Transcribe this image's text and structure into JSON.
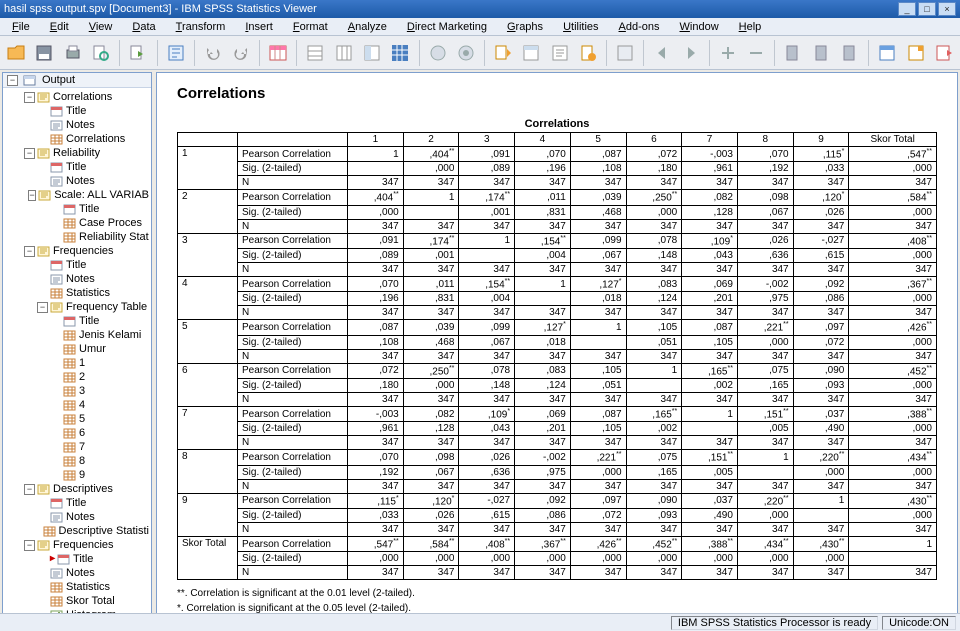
{
  "window": {
    "title": "hasil spss output.spv [Document3] - IBM SPSS Statistics Viewer",
    "min": "_",
    "max": "□",
    "close": "×"
  },
  "menu": [
    "File",
    "Edit",
    "View",
    "Data",
    "Transform",
    "Insert",
    "Format",
    "Analyze",
    "Direct Marketing",
    "Graphs",
    "Utilities",
    "Add-ons",
    "Window",
    "Help"
  ],
  "outline_root": "Output",
  "outline": [
    {
      "d": 1,
      "t": "-",
      "i": "log",
      "l": "Correlations"
    },
    {
      "d": 2,
      "t": " ",
      "i": "title",
      "l": "Title"
    },
    {
      "d": 2,
      "t": " ",
      "i": "notes",
      "l": "Notes"
    },
    {
      "d": 2,
      "t": " ",
      "i": "tbl",
      "l": "Correlations"
    },
    {
      "d": 1,
      "t": "-",
      "i": "log",
      "l": "Reliability"
    },
    {
      "d": 2,
      "t": " ",
      "i": "title",
      "l": "Title"
    },
    {
      "d": 2,
      "t": " ",
      "i": "notes",
      "l": "Notes"
    },
    {
      "d": 2,
      "t": "-",
      "i": "log",
      "l": "Scale: ALL VARIAB"
    },
    {
      "d": 3,
      "t": " ",
      "i": "title",
      "l": "Title"
    },
    {
      "d": 3,
      "t": " ",
      "i": "tbl",
      "l": "Case Proces"
    },
    {
      "d": 3,
      "t": " ",
      "i": "tbl",
      "l": "Reliability Stat"
    },
    {
      "d": 1,
      "t": "-",
      "i": "log",
      "l": "Frequencies"
    },
    {
      "d": 2,
      "t": " ",
      "i": "title",
      "l": "Title"
    },
    {
      "d": 2,
      "t": " ",
      "i": "notes",
      "l": "Notes"
    },
    {
      "d": 2,
      "t": " ",
      "i": "tbl",
      "l": "Statistics"
    },
    {
      "d": 2,
      "t": "-",
      "i": "log",
      "l": "Frequency Table"
    },
    {
      "d": 3,
      "t": " ",
      "i": "title",
      "l": "Title"
    },
    {
      "d": 3,
      "t": " ",
      "i": "tbl",
      "l": "Jenis Kelami"
    },
    {
      "d": 3,
      "t": " ",
      "i": "tbl",
      "l": "Umur"
    },
    {
      "d": 3,
      "t": " ",
      "i": "tbl",
      "l": "1"
    },
    {
      "d": 3,
      "t": " ",
      "i": "tbl",
      "l": "2"
    },
    {
      "d": 3,
      "t": " ",
      "i": "tbl",
      "l": "3"
    },
    {
      "d": 3,
      "t": " ",
      "i": "tbl",
      "l": "4"
    },
    {
      "d": 3,
      "t": " ",
      "i": "tbl",
      "l": "5"
    },
    {
      "d": 3,
      "t": " ",
      "i": "tbl",
      "l": "6"
    },
    {
      "d": 3,
      "t": " ",
      "i": "tbl",
      "l": "7"
    },
    {
      "d": 3,
      "t": " ",
      "i": "tbl",
      "l": "8"
    },
    {
      "d": 3,
      "t": " ",
      "i": "tbl",
      "l": "9"
    },
    {
      "d": 1,
      "t": "-",
      "i": "log",
      "l": "Descriptives"
    },
    {
      "d": 2,
      "t": " ",
      "i": "title",
      "l": "Title"
    },
    {
      "d": 2,
      "t": " ",
      "i": "notes",
      "l": "Notes"
    },
    {
      "d": 2,
      "t": " ",
      "i": "tbl",
      "l": "Descriptive Statisti"
    },
    {
      "d": 1,
      "t": "-",
      "i": "log",
      "l": "Frequencies"
    },
    {
      "d": 2,
      "t": " ",
      "i": "title",
      "l": "Title",
      "sel": true
    },
    {
      "d": 2,
      "t": " ",
      "i": "notes",
      "l": "Notes"
    },
    {
      "d": 2,
      "t": " ",
      "i": "tbl",
      "l": "Statistics"
    },
    {
      "d": 2,
      "t": " ",
      "i": "tbl",
      "l": "Skor Total"
    },
    {
      "d": 2,
      "t": " ",
      "i": "chart",
      "l": "Histogram"
    }
  ],
  "heading": "Correlations",
  "table_caption": "Correlations",
  "columns": [
    "1",
    "2",
    "3",
    "4",
    "5",
    "6",
    "7",
    "8",
    "9",
    "Skor Total"
  ],
  "rowlabels": [
    "Pearson Correlation",
    "Sig. (2-tailed)",
    "N"
  ],
  "groups": [
    "1",
    "2",
    "3",
    "4",
    "5",
    "6",
    "7",
    "8",
    "9",
    "Skor Total"
  ],
  "matrix": [
    {
      "pc": [
        "1",
        ",404<sup>**</sup>",
        ",091",
        ",070",
        ",087",
        ",072",
        "-,003",
        ",070",
        ",115<sup>*</sup>",
        ",547<sup>**</sup>"
      ],
      "sig": [
        "",
        ",000",
        ",089",
        ",196",
        ",108",
        ",180",
        ",961",
        ",192",
        ",033",
        ",000"
      ],
      "n": [
        "347",
        "347",
        "347",
        "347",
        "347",
        "347",
        "347",
        "347",
        "347",
        "347"
      ]
    },
    {
      "pc": [
        ",404<sup>**</sup>",
        "1",
        ",174<sup>**</sup>",
        ",011",
        ",039",
        ",250<sup>**</sup>",
        ",082",
        ",098",
        ",120<sup>*</sup>",
        ",584<sup>**</sup>"
      ],
      "sig": [
        ",000",
        "",
        ",001",
        ",831",
        ",468",
        ",000",
        ",128",
        ",067",
        ",026",
        ",000"
      ],
      "n": [
        "347",
        "347",
        "347",
        "347",
        "347",
        "347",
        "347",
        "347",
        "347",
        "347"
      ]
    },
    {
      "pc": [
        ",091",
        ",174<sup>**</sup>",
        "1",
        ",154<sup>**</sup>",
        ",099",
        ",078",
        ",109<sup>*</sup>",
        ",026",
        "-,027",
        ",408<sup>**</sup>"
      ],
      "sig": [
        ",089",
        ",001",
        "",
        ",004",
        ",067",
        ",148",
        ",043",
        ",636",
        ",615",
        ",000"
      ],
      "n": [
        "347",
        "347",
        "347",
        "347",
        "347",
        "347",
        "347",
        "347",
        "347",
        "347"
      ]
    },
    {
      "pc": [
        ",070",
        ",011",
        ",154<sup>**</sup>",
        "1",
        ",127<sup>*</sup>",
        ",083",
        ",069",
        "-,002",
        ",092",
        ",367<sup>**</sup>"
      ],
      "sig": [
        ",196",
        ",831",
        ",004",
        "",
        ",018",
        ",124",
        ",201",
        ",975",
        ",086",
        ",000"
      ],
      "n": [
        "347",
        "347",
        "347",
        "347",
        "347",
        "347",
        "347",
        "347",
        "347",
        "347"
      ]
    },
    {
      "pc": [
        ",087",
        ",039",
        ",099",
        ",127<sup>*</sup>",
        "1",
        ",105",
        ",087",
        ",221<sup>**</sup>",
        ",097",
        ",426<sup>**</sup>"
      ],
      "sig": [
        ",108",
        ",468",
        ",067",
        ",018",
        "",
        ",051",
        ",105",
        ",000",
        ",072",
        ",000"
      ],
      "n": [
        "347",
        "347",
        "347",
        "347",
        "347",
        "347",
        "347",
        "347",
        "347",
        "347"
      ]
    },
    {
      "pc": [
        ",072",
        ",250<sup>**</sup>",
        ",078",
        ",083",
        ",105",
        "1",
        ",165<sup>**</sup>",
        ",075",
        ",090",
        ",452<sup>**</sup>"
      ],
      "sig": [
        ",180",
        ",000",
        ",148",
        ",124",
        ",051",
        "",
        ",002",
        ",165",
        ",093",
        ",000"
      ],
      "n": [
        "347",
        "347",
        "347",
        "347",
        "347",
        "347",
        "347",
        "347",
        "347",
        "347"
      ]
    },
    {
      "pc": [
        "-,003",
        ",082",
        ",109<sup>*</sup>",
        ",069",
        ",087",
        ",165<sup>**</sup>",
        "1",
        ",151<sup>**</sup>",
        ",037",
        ",388<sup>**</sup>"
      ],
      "sig": [
        ",961",
        ",128",
        ",043",
        ",201",
        ",105",
        ",002",
        "",
        ",005",
        ",490",
        ",000"
      ],
      "n": [
        "347",
        "347",
        "347",
        "347",
        "347",
        "347",
        "347",
        "347",
        "347",
        "347"
      ]
    },
    {
      "pc": [
        ",070",
        ",098",
        ",026",
        "-,002",
        ",221<sup>**</sup>",
        ",075",
        ",151<sup>**</sup>",
        "1",
        ",220<sup>**</sup>",
        ",434<sup>**</sup>"
      ],
      "sig": [
        ",192",
        ",067",
        ",636",
        ",975",
        ",000",
        ",165",
        ",005",
        "",
        ",000",
        ",000"
      ],
      "n": [
        "347",
        "347",
        "347",
        "347",
        "347",
        "347",
        "347",
        "347",
        "347",
        "347"
      ]
    },
    {
      "pc": [
        ",115<sup>*</sup>",
        ",120<sup>*</sup>",
        "-,027",
        ",092",
        ",097",
        ",090",
        ",037",
        ",220<sup>**</sup>",
        "1",
        ",430<sup>**</sup>"
      ],
      "sig": [
        ",033",
        ",026",
        ",615",
        ",086",
        ",072",
        ",093",
        ",490",
        ",000",
        "",
        ",000"
      ],
      "n": [
        "347",
        "347",
        "347",
        "347",
        "347",
        "347",
        "347",
        "347",
        "347",
        "347"
      ]
    },
    {
      "pc": [
        ",547<sup>**</sup>",
        ",584<sup>**</sup>",
        ",408<sup>**</sup>",
        ",367<sup>**</sup>",
        ",426<sup>**</sup>",
        ",452<sup>**</sup>",
        ",388<sup>**</sup>",
        ",434<sup>**</sup>",
        ",430<sup>**</sup>",
        "1"
      ],
      "sig": [
        ",000",
        ",000",
        ",000",
        ",000",
        ",000",
        ",000",
        ",000",
        ",000",
        ",000",
        ""
      ],
      "n": [
        "347",
        "347",
        "347",
        "347",
        "347",
        "347",
        "347",
        "347",
        "347",
        "347"
      ]
    }
  ],
  "footnotes": [
    "**. Correlation is significant at the 0.01 level (2-tailed).",
    "*. Correlation is significant at the 0.05 level (2-tailed)."
  ],
  "status": {
    "processor": "IBM SPSS Statistics Processor is ready",
    "unicode": "Unicode:ON"
  }
}
